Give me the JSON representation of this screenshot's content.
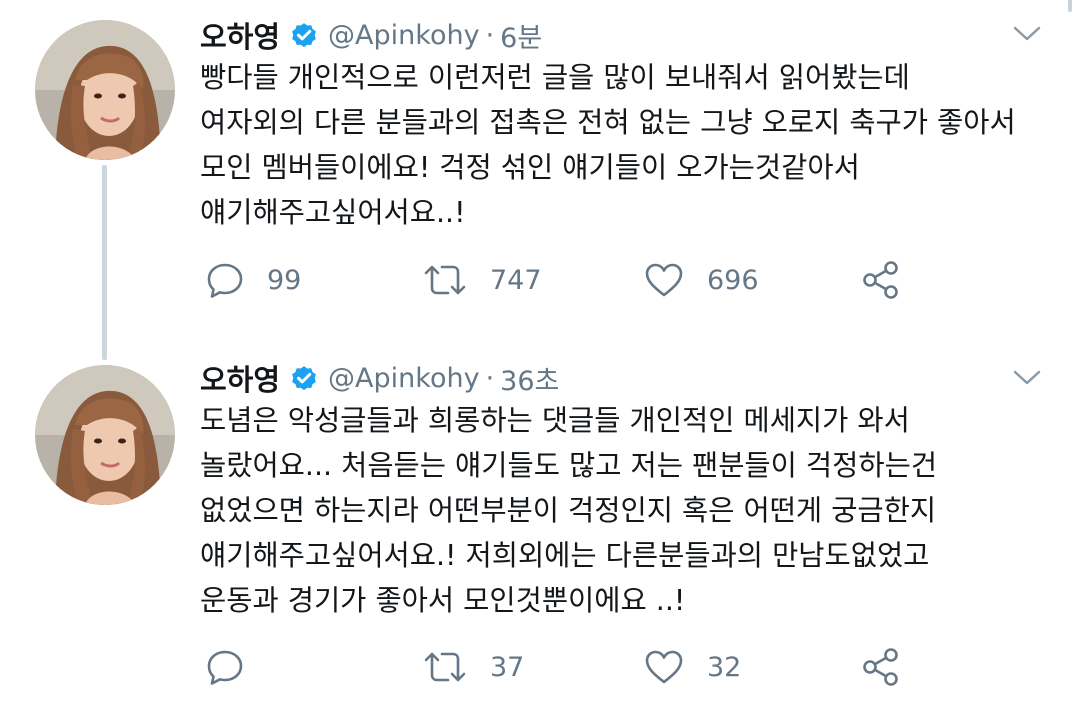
{
  "colors": {
    "verified": "#1da1f2",
    "secondary_text": "#657786",
    "icon": "#657786",
    "thread_line": "#ccd6dd"
  },
  "tweets": [
    {
      "author": {
        "name": "오하영",
        "handle": "@Apinkohy",
        "verified_icon": "verified-badge-icon",
        "avatar": "profile-photo"
      },
      "separator": "·",
      "time": "6분",
      "lines": [
        "빵다들 개인적으로 이런저런 글을 많이 보내줘서 읽어봤는데",
        "여자외의 다른 분들과의 접촉은 전혀 없는 그냥 오로지 축구가 좋아서",
        "모인 멤버들이에요! 걱정 섞인 얘기들이 오가는것같아서",
        "얘기해주고싶어서요..!"
      ],
      "actions": {
        "replies": "99",
        "retweets": "747",
        "likes": "696"
      }
    },
    {
      "author": {
        "name": "오하영",
        "handle": "@Apinkohy",
        "verified_icon": "verified-badge-icon",
        "avatar": "profile-photo"
      },
      "separator": "·",
      "time": "36초",
      "lines": [
        "도념은 악성글들과 희롱하는 댓글들 개인적인 메세지가 와서",
        "놀랐어요... 처음듣는 얘기들도 많고 저는 팬분들이 걱정하는건",
        "없었으면 하는지라 어떤부분이 걱정인지 혹은 어떤게 궁금한지",
        "얘기해주고싶어서요.! 저희외에는 다른분들과의 만남도없었고",
        "운동과 경기가 좋아서 모인것뿐이에요 ..!"
      ],
      "actions": {
        "replies": "",
        "retweets": "37",
        "likes": "32"
      }
    }
  ]
}
